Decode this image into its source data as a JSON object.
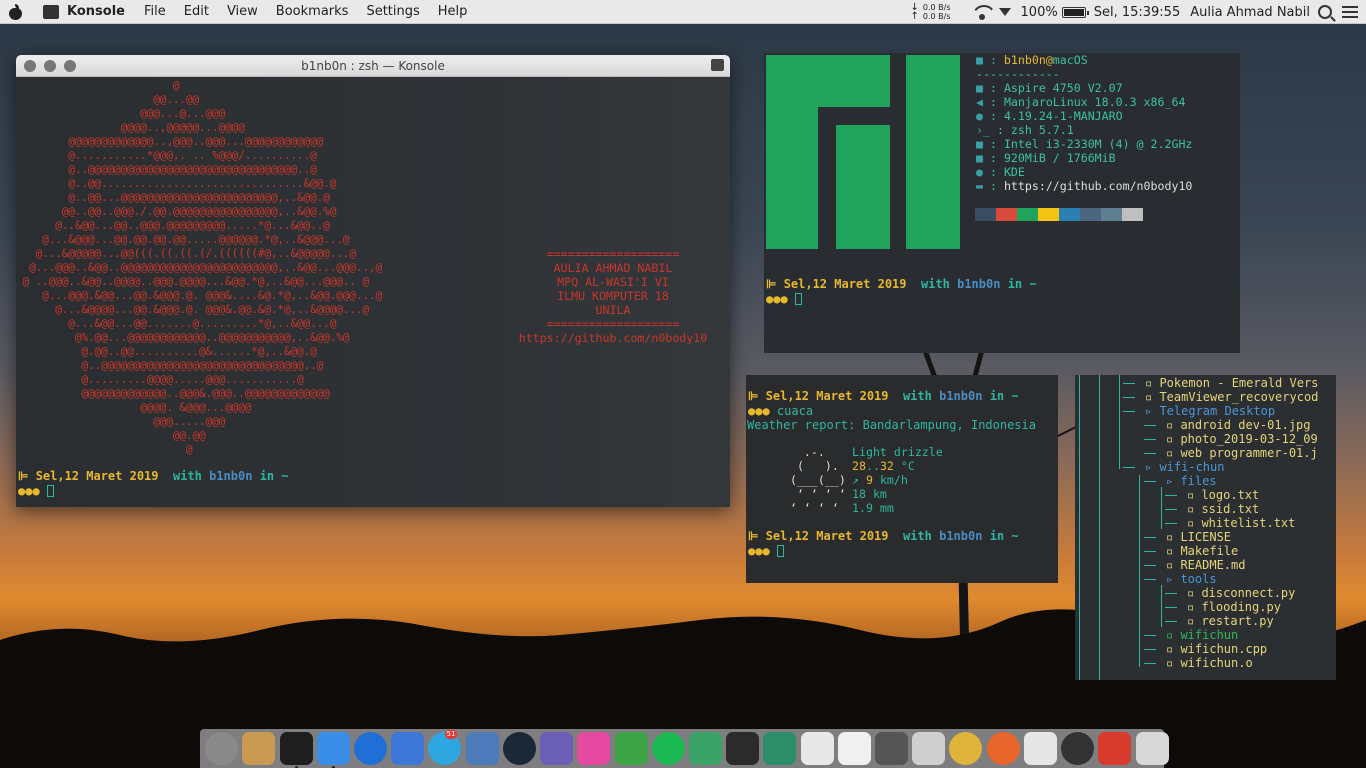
{
  "menubar": {
    "app_name": "Konsole",
    "items": [
      "File",
      "Edit",
      "View",
      "Bookmarks",
      "Settings",
      "Help"
    ],
    "net_up": "0.0 B/s",
    "net_down": "0.0 B/s",
    "battery": "100%",
    "clock": "Sel, 15:39:55",
    "user": "Aulia Ahmad Nabil"
  },
  "konsole": {
    "title": "b1nb0n : zsh — Konsole",
    "ascii_art": "                        @\n                     @@...@@\n                   @@@...@...@@@\n                @@@@..,@@@@@...@@@@\n        @@@@@@@@@@@@@..,@@@..@@@...@@@@@@@@@@@@\n        @...........*@@@,. .. %@@@/..........@\n        @..@@@@@@@@@@@@@@@@@@@@@@@@@@@@@@@@..@\n        @..@@...............................&@@.@\n        @..@@...@@@@@@@@@@@@@@@@@@@@@@@@,..&@@.@\n       @@..@@..@@@./.@@.@@@@@@@@@@@@@@@@,..&@@.%@\n      @..&@@...@@..@@@.@@@@@@@@@.....*@...&@@..@\n    @...&@@@...@@.@@.@@.@@.....@@@@@@.*@,..&@@@...@\n   @...&@@@@@...@@(((.((.((.(/.((((((#@,..&@@@@@...@\n  @...@@@..&@@..@@@@@@@@@@@@@@@@@@@@@@@@,..&@@...@@@..,@\n @ ..@@@..&@@..@@@@..@@@.@@@@...&@@.*@,..&@@...@@@.. @\n    @...@@@.&@@...@@.&@@@.@. @@@&....&@.*@,..&@@.@@@...@\n      @...&@@@@...@@.&@@@.@. @@@&.@@.&@.*@,..&@@@@...@\n        @...&@@...@@.......@.........*@,..&@@...@\n         @%.@@...@@@@@@@@@@@@..@@@@@@@@@@@,..&@@.%@\n          @.@@..@@..........@&......*@,..&@@.@\n          @..@@@@@@@@@@@@@@@@@@@@@@@@@@@@@@@..@\n          @.........@@@@.....@@@...........@\n          @@@@@@@@@@@@@..@@@&.@@@..@@@@@@@@@@@@@\n                   @@@@. &@@@...@@@@\n                     @@@.....@@@\n                        @@.@@\n                          @",
    "info_lines": [
      "===================",
      "AULIA AHMAD NABIL",
      "MPQ AL-WASI'I VI",
      "ILMU KOMPUTER 18",
      "UNILA",
      "===================",
      "https://github.com/n0body10"
    ],
    "prompt_date": "Sel,12 Maret 2019",
    "prompt_with": "with",
    "prompt_user": "b1nb0n",
    "prompt_in": "in",
    "prompt_dir": "~",
    "prompt_dots": "●●●"
  },
  "neofetch": {
    "header_user": "b1nb0n",
    "header_at": "@",
    "header_host": "macOS",
    "separator": "------------",
    "rows": [
      {
        "icon": "■",
        "value": "Aspire 4750 V2.07"
      },
      {
        "icon": "◀",
        "value": "ManjaroLinux 18.0.3 x86_64"
      },
      {
        "icon": "●",
        "value": "4.19.24-1-MANJARO"
      },
      {
        "icon": "›_",
        "value": "zsh 5.7.1"
      },
      {
        "icon": "■",
        "value": "Intel i3-2330M (4) @ 2.2GHz"
      },
      {
        "icon": "■",
        "value": "920MiB / 1766MiB"
      },
      {
        "icon": "●",
        "value": "KDE"
      },
      {
        "icon": "▬",
        "value": "https://github.com/n0body10"
      }
    ],
    "palette": [
      "#3b4d63",
      "#d84a3c",
      "#20a35c",
      "#f2c312",
      "#2c7fb2",
      "#4c6680",
      "#5f7e92",
      "#bfbfbf"
    ],
    "prompt_date": "Sel,12 Maret 2019"
  },
  "weather": {
    "prompt_date": "Sel,12 Maret 2019",
    "command": "cuaca",
    "report": "Weather report: Bandarlampung, Indonesia",
    "cloud_art": "    .-.\n   (   ).\n  (___(__)\n   ʻ ʻ ʻ ʻ\n  ʻ ʻ ʻ ʻ",
    "condition": "Light drizzle",
    "temp_low": "28",
    "temp_high": "32",
    "temp_unit": "°C",
    "wind_arrow": "↗",
    "wind": "9",
    "wind_unit": "km/h",
    "visibility": "18 km",
    "precip": "1.9 mm"
  },
  "filetree": {
    "entries": [
      {
        "name": "Pokemon - Emerald Vers",
        "kind": "file",
        "level": 2
      },
      {
        "name": "TeamViewer_recoverycod",
        "kind": "file",
        "level": 2
      },
      {
        "name": "Telegram Desktop",
        "kind": "dir",
        "level": 2
      },
      {
        "name": "android dev-01.jpg",
        "kind": "file",
        "level": 3
      },
      {
        "name": "photo_2019-03-12_09",
        "kind": "file",
        "level": 3
      },
      {
        "name": "web programmer-01.j",
        "kind": "file",
        "level": 3
      },
      {
        "name": "wifi-chun",
        "kind": "dir",
        "level": 2
      },
      {
        "name": "files",
        "kind": "dir",
        "level": 3
      },
      {
        "name": "logo.txt",
        "kind": "file",
        "level": 4
      },
      {
        "name": "ssid.txt",
        "kind": "file",
        "level": 4
      },
      {
        "name": "whitelist.txt",
        "kind": "file",
        "level": 4
      },
      {
        "name": "LICENSE",
        "kind": "file",
        "level": 3
      },
      {
        "name": "Makefile",
        "kind": "file",
        "level": 3
      },
      {
        "name": "README.md",
        "kind": "file",
        "level": 3
      },
      {
        "name": "tools",
        "kind": "dir",
        "level": 3
      },
      {
        "name": "disconnect.py",
        "kind": "file",
        "level": 4
      },
      {
        "name": "flooding.py",
        "kind": "file",
        "level": 4
      },
      {
        "name": "restart.py",
        "kind": "file",
        "level": 4
      },
      {
        "name": "wifichun",
        "kind": "exe",
        "level": 3
      },
      {
        "name": "wifichun.cpp",
        "kind": "file",
        "level": 3
      },
      {
        "name": "wifichun.o",
        "kind": "file",
        "level": 3
      }
    ]
  },
  "dock": {
    "items": [
      {
        "name": "system-preferences-icon",
        "color": "#8a8a8a"
      },
      {
        "name": "archive-icon",
        "color": "#c99a52"
      },
      {
        "name": "terminal-icon",
        "color": "#1e1e1e"
      },
      {
        "name": "finder-icon",
        "color": "#3b8ee8"
      },
      {
        "name": "teamviewer-icon",
        "color": "#1f6fd6"
      },
      {
        "name": "app-store-icon",
        "color": "#3d78d8"
      },
      {
        "name": "telegram-icon",
        "color": "#2ea6df",
        "badge": "51"
      },
      {
        "name": "preview-icon",
        "color": "#4d7ab8"
      },
      {
        "name": "steam-icon",
        "color": "#1b2838"
      },
      {
        "name": "game-console-icon",
        "color": "#6b5fb8"
      },
      {
        "name": "folder-pink-icon",
        "color": "#e64aa0"
      },
      {
        "name": "download-icon",
        "color": "#3ca445"
      },
      {
        "name": "spotify-icon",
        "color": "#1db954"
      },
      {
        "name": "tool-icon",
        "color": "#3aa468"
      },
      {
        "name": "sublime-icon",
        "color": "#2b2b2b"
      },
      {
        "name": "plant-icon",
        "color": "#2c8f6a"
      },
      {
        "name": "document-icon",
        "color": "#e8e8e8"
      },
      {
        "name": "notes-icon",
        "color": "#f0f0f0"
      },
      {
        "name": "arrow-icon",
        "color": "#555555"
      },
      {
        "name": "image-editor-icon",
        "color": "#cfcfcf"
      },
      {
        "name": "chrome-icon",
        "color": "#e0b33a"
      },
      {
        "name": "firefox-icon",
        "color": "#e8652b"
      },
      {
        "name": "photos-icon",
        "color": "#e6e6e6"
      },
      {
        "name": "activity-monitor-icon",
        "color": "#333333"
      },
      {
        "name": "app-red-icon",
        "color": "#d83a2c"
      },
      {
        "name": "app-grey-icon",
        "color": "#d8d8d8"
      }
    ]
  }
}
